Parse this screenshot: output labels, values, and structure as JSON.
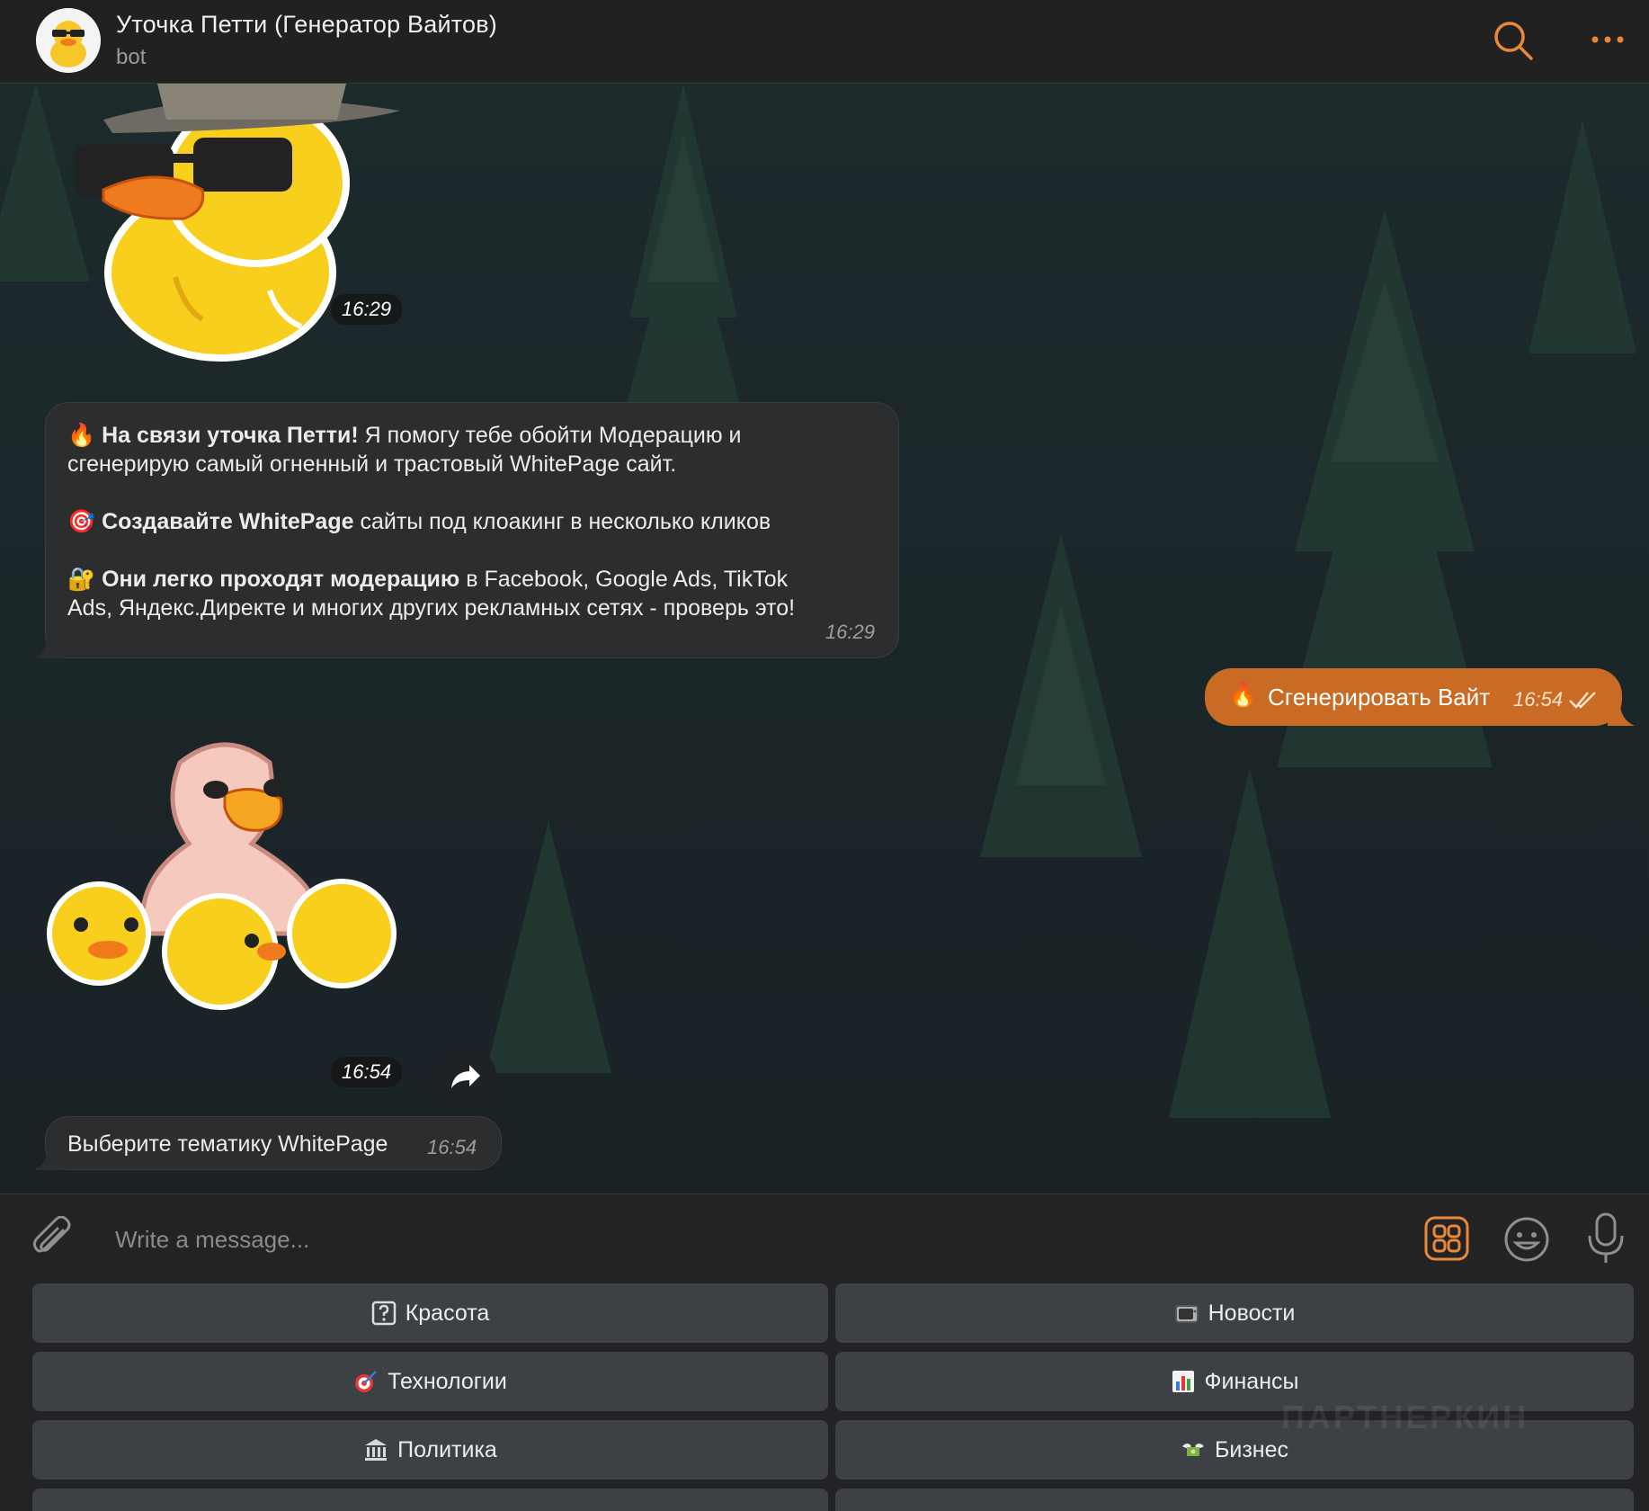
{
  "header": {
    "title": "Уточка Петти (Генератор Вайтов)",
    "subtitle": "bot"
  },
  "messages": {
    "sticker1_time": "16:29",
    "text1": {
      "l1_bold": "На связи уточка Петти!",
      "l1_rest": " Я помогу тебе обойти Модерацию и",
      "l2": "сгенерирую самый огненный и трастовый WhitePage сайт.",
      "l3_bold": "Создавайте WhitePage",
      "l3_rest": " сайты под клоакинг в несколько кликов",
      "l4_bold": "Они легко проходят модерацию",
      "l4_rest": " в Facebook, Google Ads, TikTok",
      "l5": "Ads, Яндекс.Директе и многих других рекламных сетях - проверь это!",
      "time": "16:29"
    },
    "outgoing": {
      "text": "Сгенерировать Вайт",
      "time": "16:54"
    },
    "sticker2_time": "16:54",
    "text2": {
      "text": "Выберите тематику WhitePage",
      "time": "16:54"
    }
  },
  "composer": {
    "placeholder": "Write a message..."
  },
  "keyboard": {
    "buttons": [
      {
        "label": "Красота",
        "icon": "question-box-icon"
      },
      {
        "label": "Новости",
        "icon": "television-icon"
      },
      {
        "label": "Технологии",
        "icon": "dart-icon"
      },
      {
        "label": "Финансы",
        "icon": "bar-chart-icon"
      },
      {
        "label": "Политика",
        "icon": "classical-building-icon"
      },
      {
        "label": "Бизнес",
        "icon": "money-wings-icon"
      }
    ]
  },
  "watermark": "ПАРТНЕРКИН",
  "colors": {
    "accent": "#e8893a",
    "outgoing_bubble": "#c96b25",
    "incoming_bubble": "#2b2d2f",
    "keyboard_button": "#3d4146",
    "header_bg": "#212121"
  }
}
